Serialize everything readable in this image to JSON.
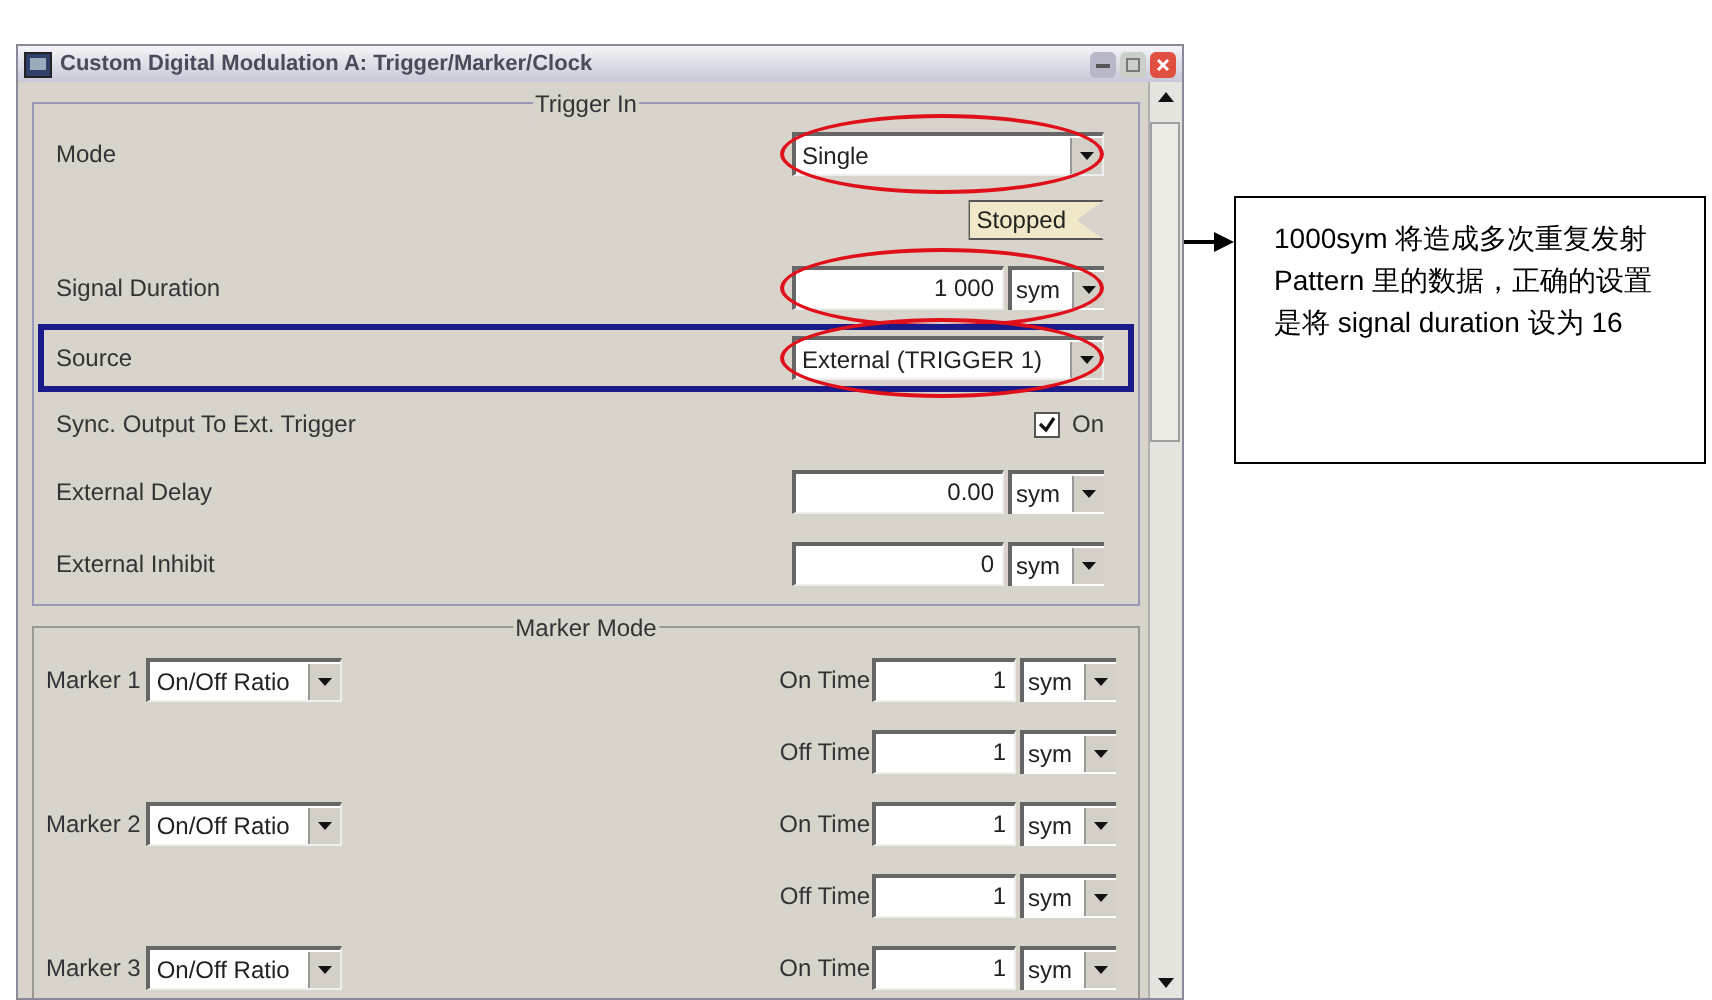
{
  "window": {
    "title": "Custom Digital Modulation  A: Trigger/Marker/Clock"
  },
  "trigger_in": {
    "title": "Trigger In",
    "rows": [
      {
        "kind": "dropdown",
        "label": "Mode",
        "value": "Single",
        "selected": false,
        "circled": true
      },
      {
        "kind": "status",
        "value": "Stopped",
        "selected": false,
        "circled": false
      },
      {
        "kind": "value_unit",
        "label": "Signal Duration",
        "value": "1 000",
        "unit": "sym",
        "selected": false,
        "circled": true
      },
      {
        "kind": "dropdown",
        "label": "Source",
        "value": "External (TRIGGER 1)",
        "selected": true,
        "circled": true
      },
      {
        "kind": "checkbox",
        "label": "Sync. Output To Ext. Trigger",
        "value": "On",
        "checked": true,
        "selected": false,
        "circled": false
      },
      {
        "kind": "value_unit",
        "label": "External Delay",
        "value": "0.00",
        "unit": "sym",
        "selected": false,
        "circled": false
      },
      {
        "kind": "value_unit",
        "label": "External Inhibit",
        "value": "0",
        "unit": "sym",
        "selected": false,
        "circled": false
      }
    ]
  },
  "marker_mode": {
    "title": "Marker Mode",
    "markers": [
      {
        "label": "Marker 1",
        "mode": "On/Off Ratio",
        "times": [
          {
            "label": "On Time",
            "value": "1",
            "unit": "sym"
          },
          {
            "label": "Off Time",
            "value": "1",
            "unit": "sym"
          }
        ]
      },
      {
        "label": "Marker 2",
        "mode": "On/Off Ratio",
        "times": [
          {
            "label": "On Time",
            "value": "1",
            "unit": "sym"
          },
          {
            "label": "Off Time",
            "value": "1",
            "unit": "sym"
          }
        ]
      },
      {
        "label": "Marker 3",
        "mode": "On/Off Ratio",
        "times": [
          {
            "label": "On Time",
            "value": "1",
            "unit": "sym"
          }
        ]
      }
    ]
  },
  "callout": {
    "text": "1000sym 将造成多次重复发射 Pattern 里的数据，正确的设置是将 signal duration 设为 16"
  }
}
